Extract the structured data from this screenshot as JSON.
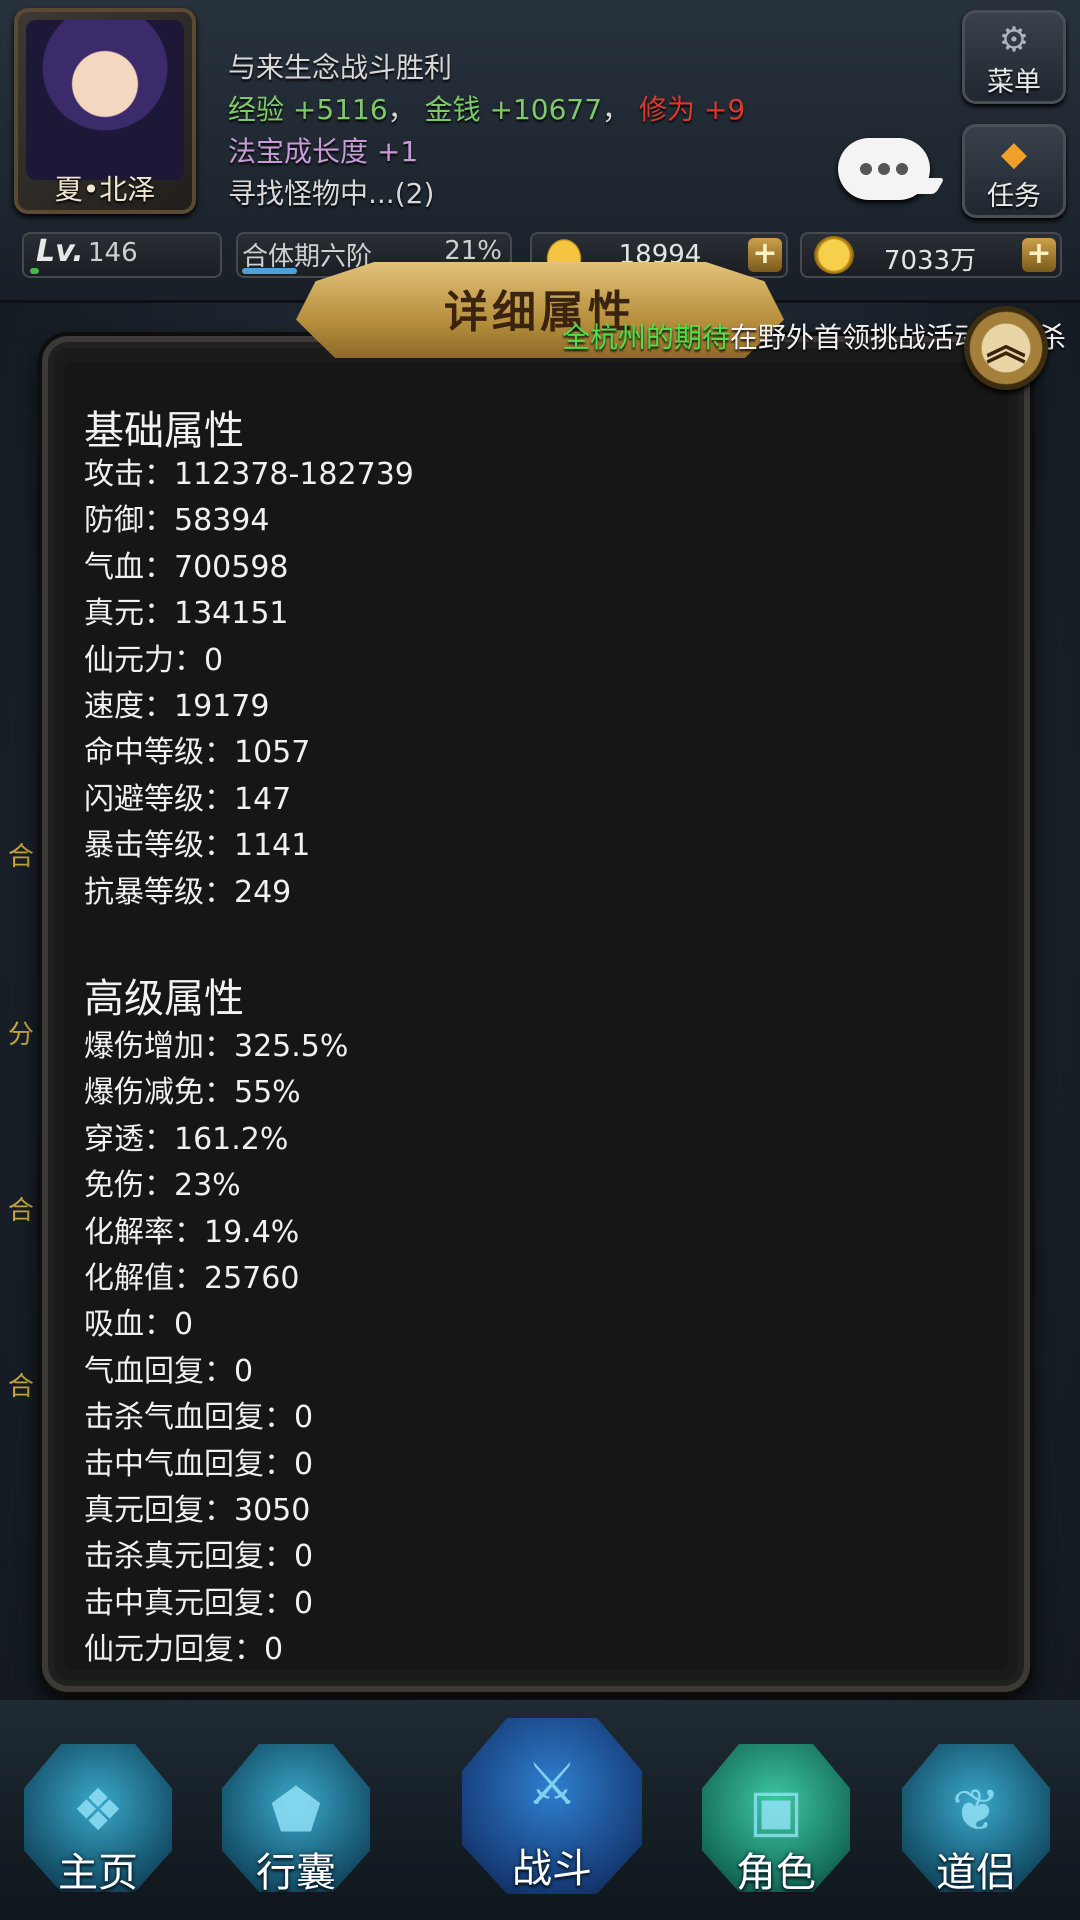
{
  "header": {
    "character_name": "夏•北泽",
    "log": {
      "line1": "与来生念战斗胜利",
      "exp_label": "经验",
      "exp_value": "+5116",
      "sep1": "，",
      "money_label": "金钱",
      "money_value": "+10677",
      "sep2": "，",
      "cultivation_label": "修为",
      "cultivation_value": "+9",
      "line3": "法宝成长度 +1",
      "line4": "寻找怪物中...(2)"
    },
    "menu_label": "菜单",
    "task_label": "任务",
    "icons": {
      "menu": "gear-icon",
      "task": "diamond-icon",
      "chat": "chat-bubble-icon"
    }
  },
  "status_bar": {
    "level_label": "Lv.",
    "level_value": "146",
    "level_progress": 0.05,
    "realm_name": "合体期六阶",
    "realm_percent": "21%",
    "realm_progress": 0.21,
    "ingot_value": "18994",
    "gold_value": "7033万",
    "plus": "+"
  },
  "panel": {
    "title": "详细属性",
    "close_icon": "chevron-up-icon",
    "marquee_highlight": "全杭州的期待",
    "marquee_text": "在野外首领挑战活动中击杀",
    "basic_title": "基础属性",
    "basic_stats": [
      "攻击：112378-182739",
      "防御：58394",
      "气血：700598",
      "真元：134151",
      "仙元力：0",
      "速度：19179",
      "命中等级：1057",
      "闪避等级：147",
      "暴击等级：1141",
      "抗暴等级：249"
    ],
    "advanced_title": "高级属性",
    "advanced_stats": [
      "爆伤增加：325.5%",
      "爆伤减免：55%",
      "穿透：161.2%",
      "免伤：23%",
      "化解率：19.4%",
      "化解值：25760",
      "吸血：0",
      "气血回复：0",
      "击杀气血回复：0",
      "击中气血回复：0",
      "真元回复：3050",
      "击杀真元回复：0",
      "击中真元回复：0",
      "仙元力回复：0"
    ]
  },
  "background": {
    "left_tags": [
      "合",
      "分",
      "合",
      "合"
    ]
  },
  "bottom_nav": [
    {
      "label": "主页",
      "icon": "home-icon"
    },
    {
      "label": "行囊",
      "icon": "bag-icon"
    },
    {
      "label": "战斗",
      "icon": "swords-icon"
    },
    {
      "label": "角色",
      "icon": "role-icon"
    },
    {
      "label": "道侣",
      "icon": "partner-icon"
    }
  ]
}
